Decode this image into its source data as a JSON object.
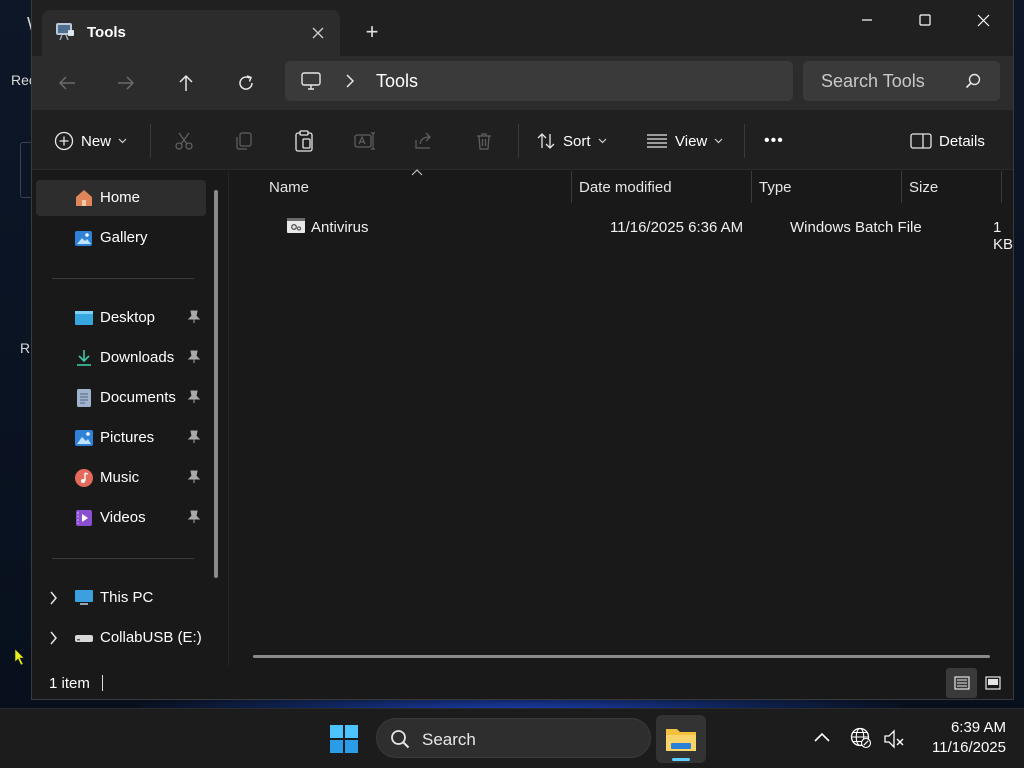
{
  "desktop": {
    "label_1": "Rec",
    "label_2": "Ri"
  },
  "window": {
    "tab_title": "Tools",
    "new_tab_symbol": "+"
  },
  "nav": {
    "breadcrumb": [
      "Tools"
    ],
    "search_placeholder": "Search Tools"
  },
  "toolbar": {
    "new_label": "New",
    "sort_label": "Sort",
    "view_label": "View",
    "more_label": "•••",
    "details_label": "Details"
  },
  "sidebar": {
    "home": "Home",
    "gallery": "Gallery",
    "desktop": "Desktop",
    "downloads": "Downloads",
    "documents": "Documents",
    "pictures": "Pictures",
    "music": "Music",
    "videos": "Videos",
    "this_pc": "This PC",
    "usb": "CollabUSB (E:)"
  },
  "columns": {
    "name": "Name",
    "date": "Date modified",
    "type": "Type",
    "size": "Size"
  },
  "files": [
    {
      "name": "Antivirus",
      "date": "11/16/2025 6:36 AM",
      "type": "Windows Batch File",
      "size": "1 KB"
    }
  ],
  "status": {
    "count": "1 item"
  },
  "taskbar": {
    "search_label": "Search",
    "time": "6:39 AM",
    "date": "11/16/2025"
  },
  "colors": {
    "window_bg": "#191919",
    "accent": "#60cdff",
    "folder_yellow": "#f3c13d"
  }
}
